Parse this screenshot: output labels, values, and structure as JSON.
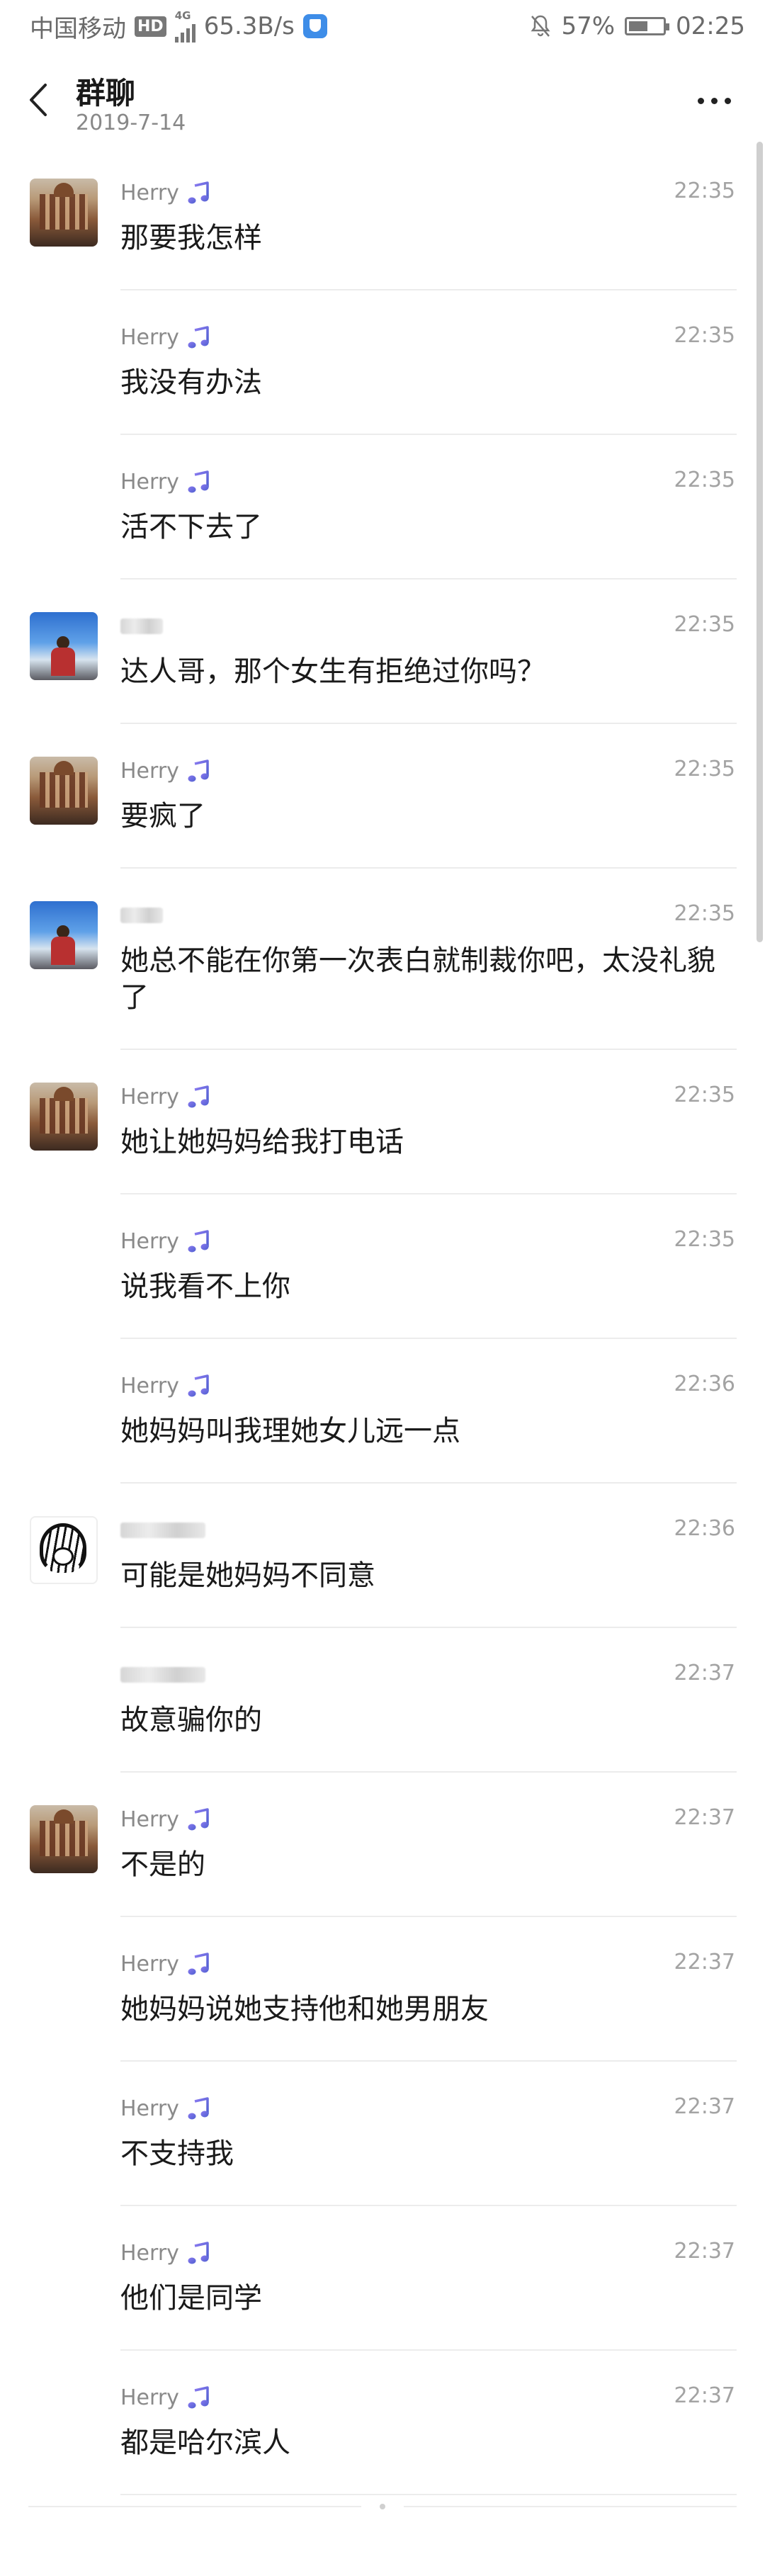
{
  "status_bar": {
    "carrier": "中国移动",
    "hd_badge": "HD",
    "network": "4G",
    "speed": "65.3B/s",
    "battery": "57%",
    "battery_level": 0.57,
    "time": "02:25"
  },
  "header": {
    "title": "群聊",
    "subtitle": "2019-7-14"
  },
  "messages": [
    {
      "sender": "Herry",
      "show_avatar": true,
      "avatar": "building",
      "music": true,
      "time": "22:35",
      "text": "那要我怎样"
    },
    {
      "sender": "Herry",
      "show_avatar": false,
      "avatar": "building",
      "music": true,
      "time": "22:35",
      "text": "我没有办法"
    },
    {
      "sender": "Herry",
      "show_avatar": false,
      "avatar": "building",
      "music": true,
      "time": "22:35",
      "text": "活不下去了"
    },
    {
      "sender": "",
      "show_avatar": true,
      "avatar": "sky",
      "music": false,
      "blurred": "short",
      "time": "22:35",
      "text": "达人哥，那个女生有拒绝过你吗？"
    },
    {
      "sender": "Herry",
      "show_avatar": true,
      "avatar": "building",
      "music": true,
      "time": "22:35",
      "text": "要疯了"
    },
    {
      "sender": "",
      "show_avatar": true,
      "avatar": "sky",
      "music": false,
      "blurred": "short",
      "time": "22:35",
      "text": "她总不能在你第一次表白就制裁你吧，太没礼貌了"
    },
    {
      "sender": "Herry",
      "show_avatar": true,
      "avatar": "building",
      "music": true,
      "time": "22:35",
      "text": "她让她妈妈给我打电话"
    },
    {
      "sender": "Herry",
      "show_avatar": false,
      "avatar": "building",
      "music": true,
      "time": "22:35",
      "text": "说我看不上你"
    },
    {
      "sender": "Herry",
      "show_avatar": false,
      "avatar": "building",
      "music": true,
      "time": "22:36",
      "text": "她妈妈叫我理她女儿远一点"
    },
    {
      "sender": "",
      "show_avatar": true,
      "avatar": "manga",
      "music": false,
      "blurred": "long",
      "time": "22:36",
      "text": "可能是她妈妈不同意"
    },
    {
      "sender": "",
      "show_avatar": false,
      "avatar": "manga",
      "music": false,
      "blurred": "long",
      "time": "22:37",
      "text": "故意骗你的"
    },
    {
      "sender": "Herry",
      "show_avatar": true,
      "avatar": "building",
      "music": true,
      "time": "22:37",
      "text": "不是的"
    },
    {
      "sender": "Herry",
      "show_avatar": false,
      "avatar": "building",
      "music": true,
      "time": "22:37",
      "text": "她妈妈说她支持他和她男朋友"
    },
    {
      "sender": "Herry",
      "show_avatar": false,
      "avatar": "building",
      "music": true,
      "time": "22:37",
      "text": "不支持我"
    },
    {
      "sender": "Herry",
      "show_avatar": false,
      "avatar": "building",
      "music": true,
      "time": "22:37",
      "text": "他们是同学"
    },
    {
      "sender": "Herry",
      "show_avatar": false,
      "avatar": "building",
      "music": true,
      "time": "22:37",
      "text": "都是哈尔滨人"
    }
  ],
  "colors": {
    "accent_music": "#5b5bd6",
    "divider": "#ececec",
    "meta_text": "#8a8a8a"
  }
}
